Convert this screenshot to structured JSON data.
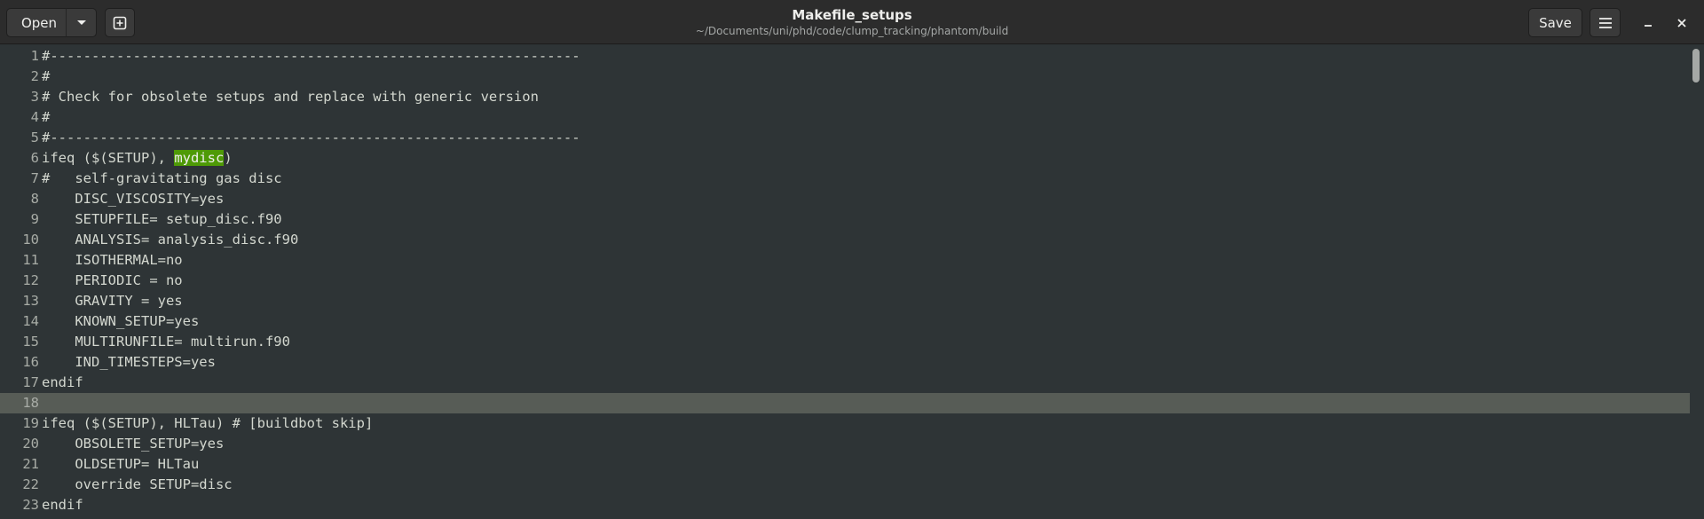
{
  "header": {
    "open_label": "Open",
    "save_label": "Save",
    "title": "Makefile_setups",
    "subtitle": "~/Documents/uni/phd/code/clump_tracking/phantom/build"
  },
  "icons": {
    "dropdown": "chevron-down-icon",
    "new_tab": "new-tab-icon",
    "menu": "hamburger-menu-icon",
    "minimize": "minimize-icon",
    "close": "close-icon"
  },
  "editor": {
    "highlight_color": "#4e9a06",
    "current_line": "18",
    "lines": [
      {
        "num": "1",
        "text": "#----------------------------------------------------------------"
      },
      {
        "num": "2",
        "text": "#"
      },
      {
        "num": "3",
        "text": "# Check for obsolete setups and replace with generic version"
      },
      {
        "num": "4",
        "text": "#"
      },
      {
        "num": "5",
        "text": "#----------------------------------------------------------------"
      },
      {
        "num": "6",
        "text": "ifeq ($(SETUP), mydisc)",
        "before": "ifeq ($(SETUP), ",
        "match": "mydisc",
        "after": ")"
      },
      {
        "num": "7",
        "text": "#   self-gravitating gas disc"
      },
      {
        "num": "8",
        "text": "    DISC_VISCOSITY=yes"
      },
      {
        "num": "9",
        "text": "    SETUPFILE= setup_disc.f90"
      },
      {
        "num": "10",
        "text": "    ANALYSIS= analysis_disc.f90"
      },
      {
        "num": "11",
        "text": "    ISOTHERMAL=no"
      },
      {
        "num": "12",
        "text": "    PERIODIC = no"
      },
      {
        "num": "13",
        "text": "    GRAVITY = yes"
      },
      {
        "num": "14",
        "text": "    KNOWN_SETUP=yes"
      },
      {
        "num": "15",
        "text": "    MULTIRUNFILE= multirun.f90"
      },
      {
        "num": "16",
        "text": "    IND_TIMESTEPS=yes"
      },
      {
        "num": "17",
        "text": "endif"
      },
      {
        "num": "18",
        "text": ""
      },
      {
        "num": "19",
        "text": "ifeq ($(SETUP), HLTau) # [buildbot skip]"
      },
      {
        "num": "20",
        "text": "    OBSOLETE_SETUP=yes"
      },
      {
        "num": "21",
        "text": "    OLDSETUP= HLTau"
      },
      {
        "num": "22",
        "text": "    override SETUP=disc"
      },
      {
        "num": "23",
        "text": "endif"
      }
    ]
  }
}
